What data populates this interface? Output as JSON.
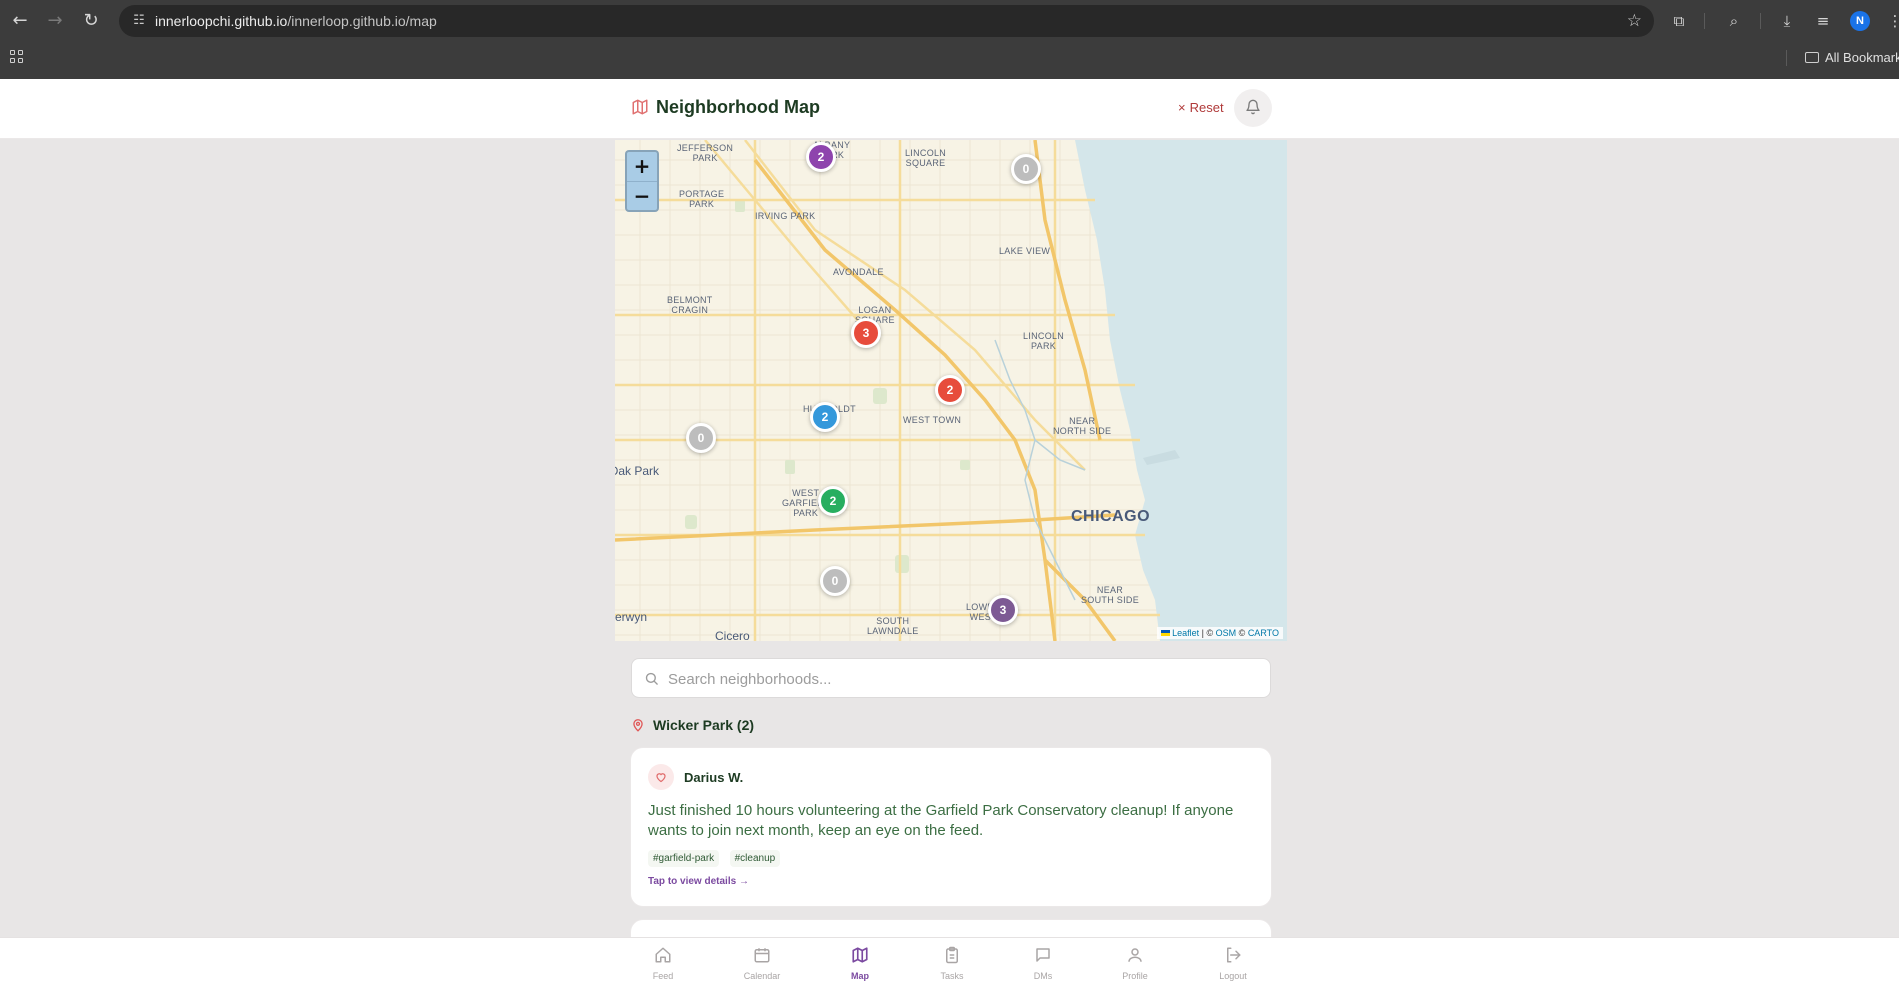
{
  "browser": {
    "url_host": "innerloopchi.github.io",
    "url_path": "/innerloop.github.io/map",
    "avatar_letter": "N",
    "bookmarks_label": "All Bookmarks"
  },
  "header": {
    "title": "Neighborhood Map",
    "reset_label": "Reset"
  },
  "map": {
    "zoom_in": "+",
    "zoom_out": "−",
    "labels": [
      {
        "text": "JEFFERSON PARK"
      },
      {
        "text": "ALBANY PARK"
      },
      {
        "text": "LINCOLN SQUARE"
      },
      {
        "text": "PORTAGE PARK"
      },
      {
        "text": "IRVING PARK"
      },
      {
        "text": "LAKE VIEW"
      },
      {
        "text": "AVONDALE"
      },
      {
        "text": "BELMONT CRAGIN"
      },
      {
        "text": "LOGAN SQUARE"
      },
      {
        "text": "LINCOLN PARK"
      },
      {
        "text": "HUMBOLDT"
      },
      {
        "text": "WEST TOWN"
      },
      {
        "text": "NEAR NORTH SIDE"
      },
      {
        "text": "Oak Park"
      },
      {
        "text": "WEST GARFIELD PARK"
      },
      {
        "text": "CHICAGO"
      },
      {
        "text": "NEAR SOUTH SIDE"
      },
      {
        "text": "SOUTH LAWNDALE"
      },
      {
        "text": "LOWER WEST"
      },
      {
        "text": "Berwyn"
      },
      {
        "text": "Cicero"
      }
    ],
    "markers": [
      {
        "count": "2",
        "color": "#8e44ad"
      },
      {
        "count": "0",
        "color": "#bdbdbd"
      },
      {
        "count": "3",
        "color": "#e74c3c"
      },
      {
        "count": "2",
        "color": "#e74c3c"
      },
      {
        "count": "2",
        "color": "#3498db"
      },
      {
        "count": "0",
        "color": "#bdbdbd"
      },
      {
        "count": "2",
        "color": "#27ae60"
      },
      {
        "count": "0",
        "color": "#bdbdbd"
      },
      {
        "count": "3",
        "color": "#7d5a94"
      }
    ],
    "attribution": {
      "leaflet": "Leaflet",
      "sep": "| ©",
      "osm": "OSM",
      "copy": "©",
      "carto": "CARTO"
    }
  },
  "search": {
    "placeholder": "Search neighborhoods..."
  },
  "section": {
    "title": "Wicker Park (2)"
  },
  "post": {
    "author": "Darius W.",
    "body": "Just finished 10 hours volunteering at the Garfield Park Conservatory cleanup! If anyone wants to join next month, keep an eye on the feed.",
    "tags": [
      "#garfield-park",
      "#cleanup"
    ],
    "details_link": "Tap to view details →"
  },
  "nav": {
    "items": [
      {
        "label": "Feed",
        "icon": "home-icon"
      },
      {
        "label": "Calendar",
        "icon": "calendar-icon"
      },
      {
        "label": "Map",
        "icon": "map-icon"
      },
      {
        "label": "Tasks",
        "icon": "clipboard-icon"
      },
      {
        "label": "DMs",
        "icon": "message-icon"
      },
      {
        "label": "Profile",
        "icon": "user-icon"
      },
      {
        "label": "Logout",
        "icon": "logout-icon"
      }
    ],
    "active": "Map"
  },
  "colors": {
    "accent": "#7b4aa0",
    "title": "#1d3b22",
    "reset": "#b03a3a",
    "body_text": "#3c6e43"
  }
}
